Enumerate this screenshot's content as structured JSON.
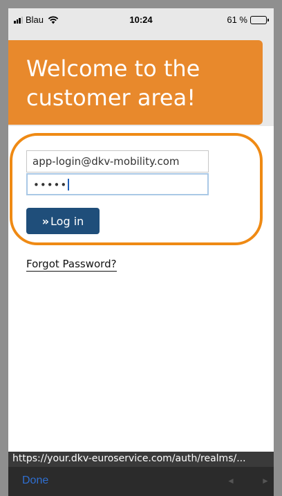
{
  "status_bar": {
    "carrier": "Blau",
    "time": "10:24",
    "battery_percent": "61 %",
    "battery_level": 0.61
  },
  "header": {
    "title_line1": "Welcome to the",
    "title_line2": "customer area!",
    "accent_color": "#e8892c"
  },
  "login": {
    "email_value": "app-login@dkv-mobility.com",
    "password_mask": "•••••",
    "button_chevron": "»",
    "button_label": "Log in",
    "highlight_color": "#ef8a14"
  },
  "links": {
    "forgot_password": "Forgot Password?"
  },
  "browser": {
    "url": "https://your.dkv-euroservice.com/auth/realms/...",
    "done_label": "Done",
    "prev_icon": "◄",
    "next_icon": "►"
  }
}
